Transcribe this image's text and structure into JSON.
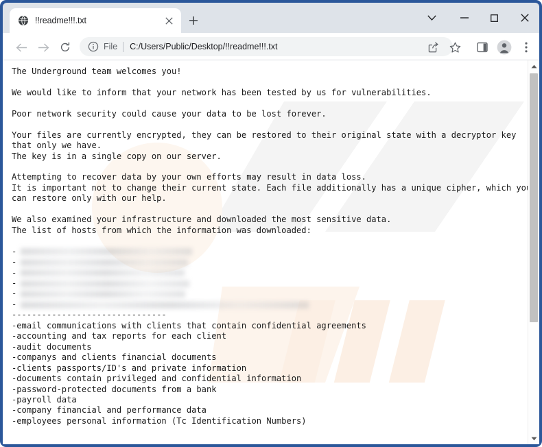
{
  "window": {
    "frame_color": "#2b579a",
    "controls": {
      "tab_search_label": "tab-search",
      "minimize_label": "minimize",
      "maximize_label": "maximize",
      "close_label": "close"
    }
  },
  "tab": {
    "title": "!!readme!!!.txt",
    "favicon": "globe-icon",
    "close_label": "×",
    "new_tab_label": "+"
  },
  "toolbar": {
    "back_label": "back",
    "forward_label": "forward",
    "reload_label": "reload",
    "share_label": "share",
    "bookmark_label": "bookmark",
    "side_panel_label": "side-panel",
    "profile_label": "profile",
    "menu_label": "menu"
  },
  "omnibox": {
    "scheme_label": "File",
    "url": "C:/Users/Public/Desktop/!!readme!!!.txt",
    "info_icon": "info-circle-icon"
  },
  "page": {
    "lines": [
      {
        "type": "text",
        "text": "The Underground team welcomes you!"
      },
      {
        "type": "blank",
        "text": ""
      },
      {
        "type": "text",
        "text": "We would like to inform that your network has been tested by us for vulnerabilities."
      },
      {
        "type": "blank",
        "text": ""
      },
      {
        "type": "text",
        "text": "Poor network security could cause your data to be lost forever."
      },
      {
        "type": "blank",
        "text": ""
      },
      {
        "type": "text",
        "text": "Your files are currently encrypted, they can be restored to their original state with a decryptor key"
      },
      {
        "type": "text",
        "text": "that only we have."
      },
      {
        "type": "text",
        "text": "The key is in a single copy on our server."
      },
      {
        "type": "blank",
        "text": ""
      },
      {
        "type": "text",
        "text": "Attempting to recover data by your own efforts may result in data loss."
      },
      {
        "type": "text",
        "text": "It is important not to change their current state. Each file additionally has a unique cipher, which you"
      },
      {
        "type": "text",
        "text": "can restore only with our help."
      },
      {
        "type": "blank",
        "text": ""
      },
      {
        "type": "text",
        "text": "We also examined your infrastructure and downloaded the most sensitive data."
      },
      {
        "type": "text",
        "text": "The list of hosts from which the information was downloaded:"
      },
      {
        "type": "blank",
        "text": ""
      },
      {
        "type": "host",
        "text": "-",
        "redacted_width": 250
      },
      {
        "type": "host",
        "text": "-",
        "redacted_width": 244
      },
      {
        "type": "host",
        "text": "-",
        "redacted_width": 239
      },
      {
        "type": "host",
        "text": "-",
        "redacted_width": 246
      },
      {
        "type": "host",
        "text": "-",
        "redacted_width": 240
      },
      {
        "type": "host",
        "text": "-",
        "redacted_width": 420
      },
      {
        "type": "text",
        "text": "-------------------------------"
      },
      {
        "type": "text",
        "text": "-email communications with clients that contain confidential agreements"
      },
      {
        "type": "text",
        "text": "-accounting and tax reports for each client"
      },
      {
        "type": "text",
        "text": "-audit documents"
      },
      {
        "type": "text",
        "text": "-companys and clients financial documents"
      },
      {
        "type": "text",
        "text": "-clients passports/ID's and private information"
      },
      {
        "type": "text",
        "text": "-documents contain privileged and confidential information"
      },
      {
        "type": "text",
        "text": "-password-protected documents from a bank"
      },
      {
        "type": "text",
        "text": "-payroll data"
      },
      {
        "type": "text",
        "text": "-company financial and performance data"
      },
      {
        "type": "text",
        "text": "-employees personal information (Tc Identification Numbers)"
      }
    ]
  },
  "scrollbar": {
    "up_arrow_label": "scroll-up",
    "down_arrow_label": "scroll-down"
  }
}
